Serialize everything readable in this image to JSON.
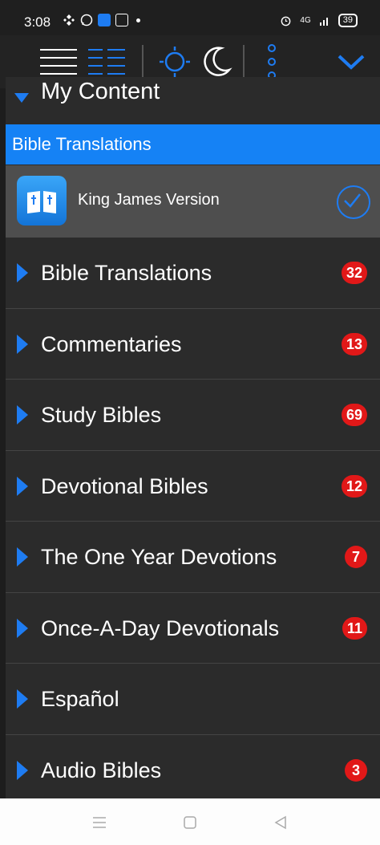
{
  "status_bar": {
    "time": "3:08",
    "network": "4G",
    "battery": "39"
  },
  "toolbar": {
    "icons": [
      "list-lines-icon",
      "list-dashed-icon",
      "sun-icon",
      "moon-icon",
      "more-vertical-icon",
      "chevron-down-icon"
    ]
  },
  "my_content": {
    "label": "My Content"
  },
  "section_header": {
    "label": "Bible Translations"
  },
  "selected": {
    "label": "King James Version"
  },
  "rows": [
    {
      "label": "Bible Translations",
      "count": "32"
    },
    {
      "label": "Commentaries",
      "count": "13"
    },
    {
      "label": "Study Bibles",
      "count": "69"
    },
    {
      "label": "Devotional Bibles",
      "count": "12"
    },
    {
      "label": "The One Year Devotions",
      "count": "7"
    },
    {
      "label": "Once-A-Day Devotionals",
      "count": "11"
    },
    {
      "label": "Español",
      "count": ""
    },
    {
      "label": "Audio Bibles",
      "count": "3"
    }
  ],
  "colors": {
    "accent": "#1e7cf2",
    "header": "#1582f5",
    "badge": "#e11818"
  }
}
